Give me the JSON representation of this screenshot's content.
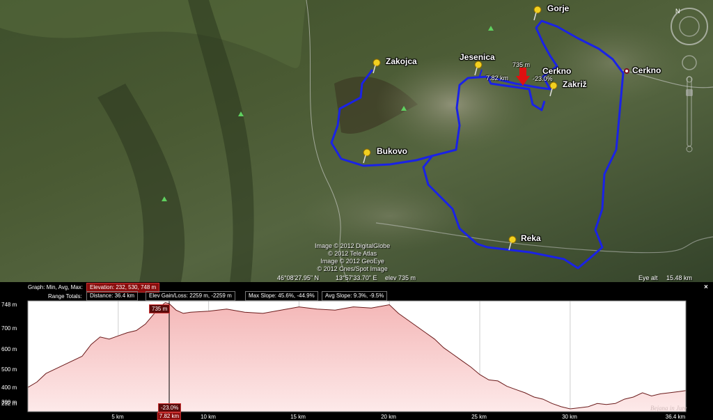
{
  "map": {
    "places": [
      {
        "name": "Gorje"
      },
      {
        "name": "Zakojca"
      },
      {
        "name": "Jesenica"
      },
      {
        "name": "Cerkno"
      },
      {
        "name": "Zakriž"
      },
      {
        "name": "Bukovo"
      },
      {
        "name": "Reka"
      }
    ],
    "town": {
      "name": "Cerkno"
    },
    "marker": {
      "elevation": "735 m",
      "distance": "7.82 km",
      "slope": "-23.0%"
    },
    "copyright": [
      "Image © 2012 DigitalGlobe",
      "© 2012 Tele Atlas",
      "Image © 2012 GeoEye",
      "© 2012 Cnes/Spot Image"
    ],
    "status": {
      "lat": "46°08'27.95\" N",
      "lon": "13°57'33.70\" E",
      "elev": "elev  735 m",
      "eye_alt_label": "Eye alt",
      "eye_alt": "15.48 km"
    },
    "colors": {
      "route": "#1a22e6",
      "pin": "#f2d020",
      "marker": "#e01010"
    }
  },
  "profile": {
    "graph_label": "Graph: Min, Avg, Max:",
    "elevation_box": "Elevation: 232, 530, 748 m",
    "range_label": "Range Totals:",
    "distance_box": "Distance: 36.4 km",
    "gain_box": "Elev Gain/Loss: 2259 m, -2259 m",
    "maxslope_box": "Max Slope: 45.6%, -44.9%",
    "avgslope_box": "Avg Slope: 9.3%, -9.5%",
    "close": "×",
    "y_ticks": [
      "748 m",
      "700 m",
      "600 m",
      "500 m",
      "400 m",
      "300 m",
      "232 m"
    ],
    "x_ticks": [
      "5 km",
      "7.82 km",
      "10 km",
      "15 km",
      "20 km",
      "25 km",
      "30 km",
      "36.4 km"
    ],
    "cursor_elev": "735 m",
    "cursor_slope": "-23.0%",
    "watermark": "Bejana in Jure"
  },
  "chart_data": {
    "type": "area",
    "xlabel": "",
    "ylabel": "",
    "xlim": [
      0,
      36.4
    ],
    "ylim": [
      232,
      748
    ],
    "x": [
      0,
      0.5,
      1,
      2,
      3,
      3.5,
      4,
      4.5,
      5,
      5.5,
      6,
      6.5,
      7,
      7.3,
      7.6,
      7.82,
      8.2,
      8.6,
      9,
      10,
      11,
      12,
      13,
      14,
      15,
      16,
      17,
      18,
      19,
      20,
      20.5,
      21,
      21.5,
      22,
      22.5,
      23,
      23.5,
      24,
      24.5,
      25,
      25.5,
      26,
      26.5,
      27,
      27.5,
      28,
      28.5,
      29,
      29.5,
      30,
      30.5,
      31,
      31.5,
      32,
      32.5,
      33,
      33.5,
      34,
      34.5,
      35,
      35.5,
      36,
      36.4
    ],
    "y": [
      345,
      370,
      410,
      450,
      490,
      545,
      580,
      570,
      585,
      600,
      610,
      640,
      690,
      720,
      740,
      735,
      705,
      690,
      695,
      700,
      710,
      695,
      690,
      705,
      720,
      710,
      705,
      720,
      715,
      730,
      690,
      660,
      630,
      600,
      570,
      530,
      500,
      470,
      440,
      405,
      380,
      375,
      350,
      335,
      320,
      300,
      290,
      270,
      255,
      245,
      250,
      255,
      270,
      265,
      270,
      290,
      300,
      320,
      305,
      315,
      320,
      325,
      330
    ]
  }
}
